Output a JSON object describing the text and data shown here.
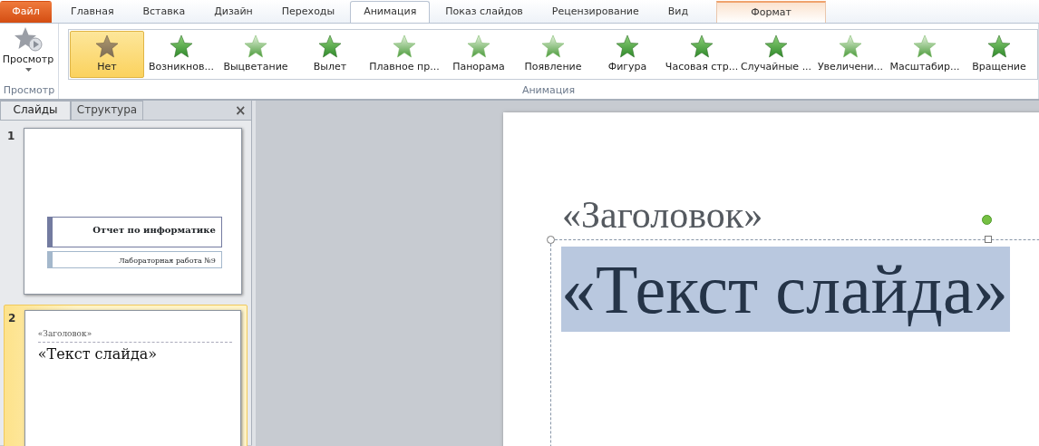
{
  "ribbon_tabs": [
    {
      "label": "Файл",
      "kind": "file",
      "selected": false
    },
    {
      "label": "Главная",
      "kind": "tab",
      "selected": false
    },
    {
      "label": "Вставка",
      "kind": "tab",
      "selected": false
    },
    {
      "label": "Дизайн",
      "kind": "tab",
      "selected": false
    },
    {
      "label": "Переходы",
      "kind": "tab",
      "selected": false
    },
    {
      "label": "Анимация",
      "kind": "tab",
      "selected": true
    },
    {
      "label": "Показ слайдов",
      "kind": "tab",
      "selected": false
    },
    {
      "label": "Рецензирование",
      "kind": "tab",
      "selected": false
    },
    {
      "label": "Вид",
      "kind": "tab",
      "selected": false
    },
    {
      "label": "Формат",
      "kind": "contextual",
      "selected": false
    }
  ],
  "preview_group": {
    "button": "Просмотр",
    "label": "Просмотр"
  },
  "animation_group": {
    "label": "Анимация",
    "effects": [
      {
        "label": "Нет",
        "kind": "none",
        "selected": true
      },
      {
        "label": "Возникнов...",
        "kind": "appear",
        "selected": false
      },
      {
        "label": "Выцветание",
        "kind": "fade",
        "selected": false
      },
      {
        "label": "Вылет",
        "kind": "fly",
        "selected": false
      },
      {
        "label": "Плавное пр...",
        "kind": "float",
        "selected": false
      },
      {
        "label": "Панорама",
        "kind": "fade",
        "selected": false
      },
      {
        "label": "Появление",
        "kind": "fade",
        "selected": false
      },
      {
        "label": "Фигура",
        "kind": "shape",
        "selected": false
      },
      {
        "label": "Часовая стр...",
        "kind": "wheel",
        "selected": false
      },
      {
        "label": "Случайные ...",
        "kind": "bars",
        "selected": false
      },
      {
        "label": "Увеличени...",
        "kind": "grow",
        "selected": false
      },
      {
        "label": "Масштабир...",
        "kind": "zoom",
        "selected": false
      },
      {
        "label": "Вращение",
        "kind": "spin",
        "selected": false
      }
    ]
  },
  "slides_panel": {
    "tabs": [
      {
        "label": "Слайды",
        "selected": true
      },
      {
        "label": "Структура",
        "selected": false
      }
    ],
    "close": "×",
    "slides": [
      {
        "number": "1",
        "selected": false,
        "kind": "title",
        "title": "Отчет по информатике",
        "subtitle": "Лабораторная работа №9"
      },
      {
        "number": "2",
        "selected": true,
        "kind": "content",
        "title": "«Заголовок»",
        "text": "«Текст слайда»"
      }
    ]
  },
  "slide": {
    "title": "«Заголовок»",
    "text": "«Текст слайда»",
    "text_selected": true
  }
}
